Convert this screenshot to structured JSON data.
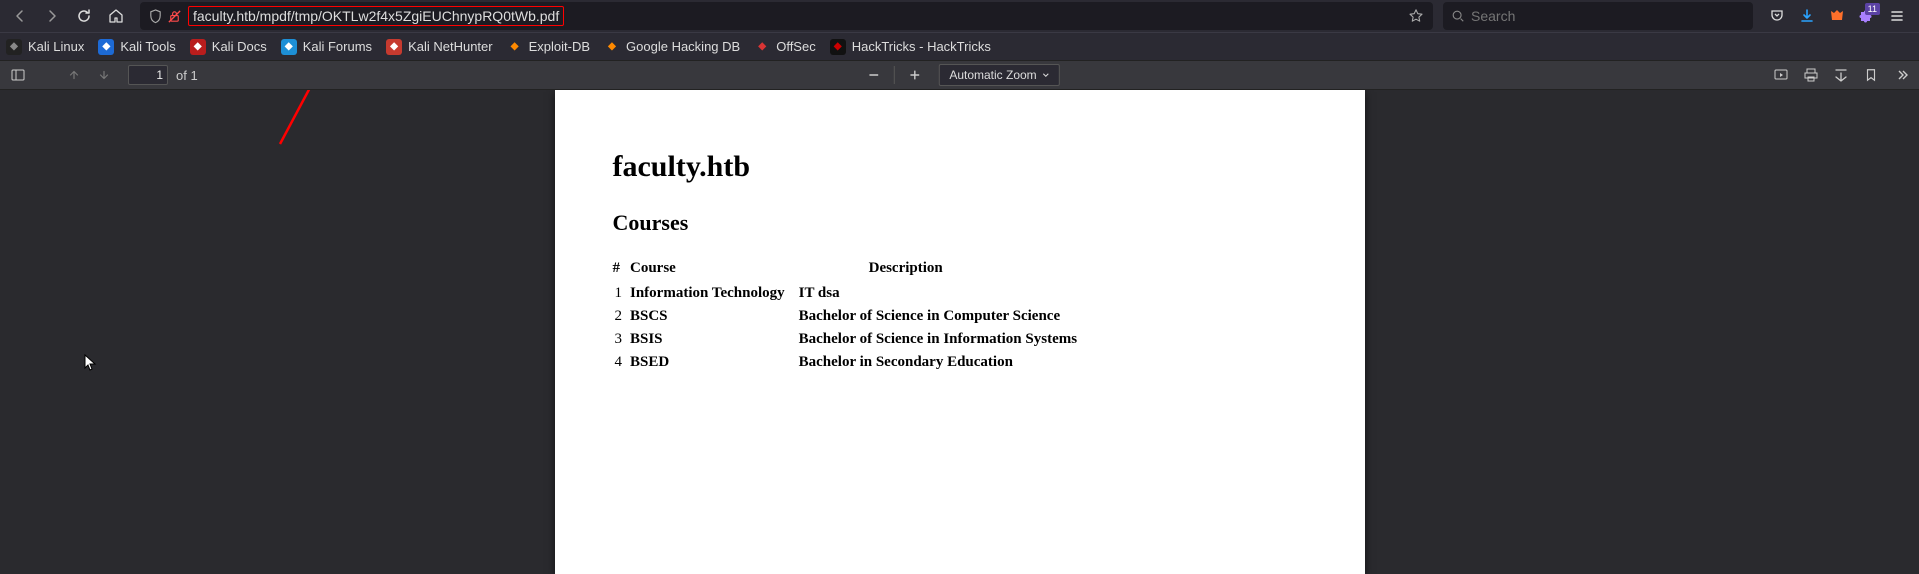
{
  "nav": {
    "url": "faculty.htb/mpdf/tmp/OKTLw2f4x5ZgiEUChnypRQ0tWb.pdf",
    "search_placeholder": "Search",
    "extension_count": "11"
  },
  "bookmarks": [
    {
      "label": "Kali Linux",
      "favicon_bg": "#222",
      "favicon_fg": "#888"
    },
    {
      "label": "Kali Tools",
      "favicon_bg": "#1d6ad6",
      "favicon_fg": "#fff"
    },
    {
      "label": "Kali Docs",
      "favicon_bg": "#b91d1d",
      "favicon_fg": "#fff"
    },
    {
      "label": "Kali Forums",
      "favicon_bg": "#1d8fd6",
      "favicon_fg": "#fff"
    },
    {
      "label": "Kali NetHunter",
      "favicon_bg": "#c63a2f",
      "favicon_fg": "#fff"
    },
    {
      "label": "Exploit-DB",
      "favicon_bg": "transparent",
      "favicon_fg": "#ff8a00"
    },
    {
      "label": "Google Hacking DB",
      "favicon_bg": "transparent",
      "favicon_fg": "#ff8a00"
    },
    {
      "label": "OffSec",
      "favicon_bg": "transparent",
      "favicon_fg": "#d93434"
    },
    {
      "label": "HackTricks - HackTricks",
      "favicon_bg": "#111",
      "favicon_fg": "#c00"
    }
  ],
  "pdf_toolbar": {
    "page_current": "1",
    "page_total": "of 1",
    "zoom_label": "Automatic Zoom"
  },
  "document": {
    "title": "faculty.htb",
    "section": "Courses",
    "headers": {
      "num": "#",
      "course": "Course",
      "desc": "Description"
    },
    "rows": [
      {
        "n": "1",
        "course": "Information Technology",
        "desc": "IT dsa"
      },
      {
        "n": "2",
        "course": "BSCS",
        "desc": "Bachelor of Science in Computer Science"
      },
      {
        "n": "3",
        "course": "BSIS",
        "desc": "Bachelor of Science in Information Systems"
      },
      {
        "n": "4",
        "course": "BSED",
        "desc": "Bachelor in Secondary Education"
      }
    ]
  }
}
